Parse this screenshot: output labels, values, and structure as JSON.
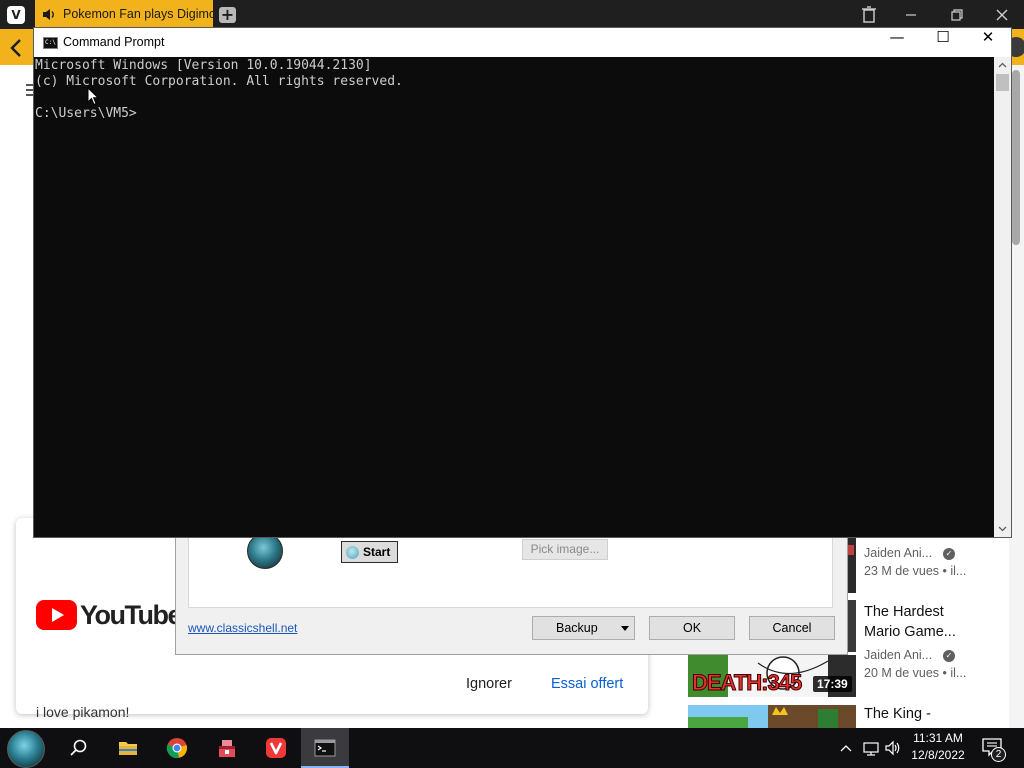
{
  "browser": {
    "tab_title": "Pokemon Fan plays Digimo",
    "logo_letter": "V",
    "new_tab_glyph": "+",
    "accent_color": "#f2b21b"
  },
  "cmd": {
    "title": "Command Prompt",
    "lines": [
      "Microsoft Windows [Version 10.0.19044.2130]",
      "(c) Microsoft Corporation. All rights reserved.",
      "",
      "C:\\Users\\VM5>"
    ],
    "minimize_glyph": "—",
    "maximize_glyph": "☐",
    "close_glyph": "✕"
  },
  "classic_shell": {
    "start_label": "Start",
    "pick_image_label": "Pick image...",
    "website_link": "www.classicshell.net",
    "backup_label": "Backup",
    "ok_label": "OK",
    "cancel_label": "Cancel"
  },
  "youtube_popup": {
    "logo_text": "YouTubeTV",
    "dismiss_label": "Ignorer",
    "trial_label": "Essai offert",
    "comment_text": "i love pikamon!"
  },
  "recommendations": [
    {
      "title_lines": [],
      "channel": "Jaiden Ani...",
      "meta": "23 M de vues  • il..."
    },
    {
      "title_lines": [
        "The Hardest",
        "Mario Game..."
      ],
      "channel": "Jaiden Ani...",
      "meta": "20 M de vues  • il...",
      "thumb_text": "DEATH:345",
      "duration": "17:39"
    },
    {
      "title_lines": [
        "The King -"
      ]
    }
  ],
  "taskbar": {
    "time": "11:31 AM",
    "date": "12/8/2022",
    "notification_count": "2"
  }
}
